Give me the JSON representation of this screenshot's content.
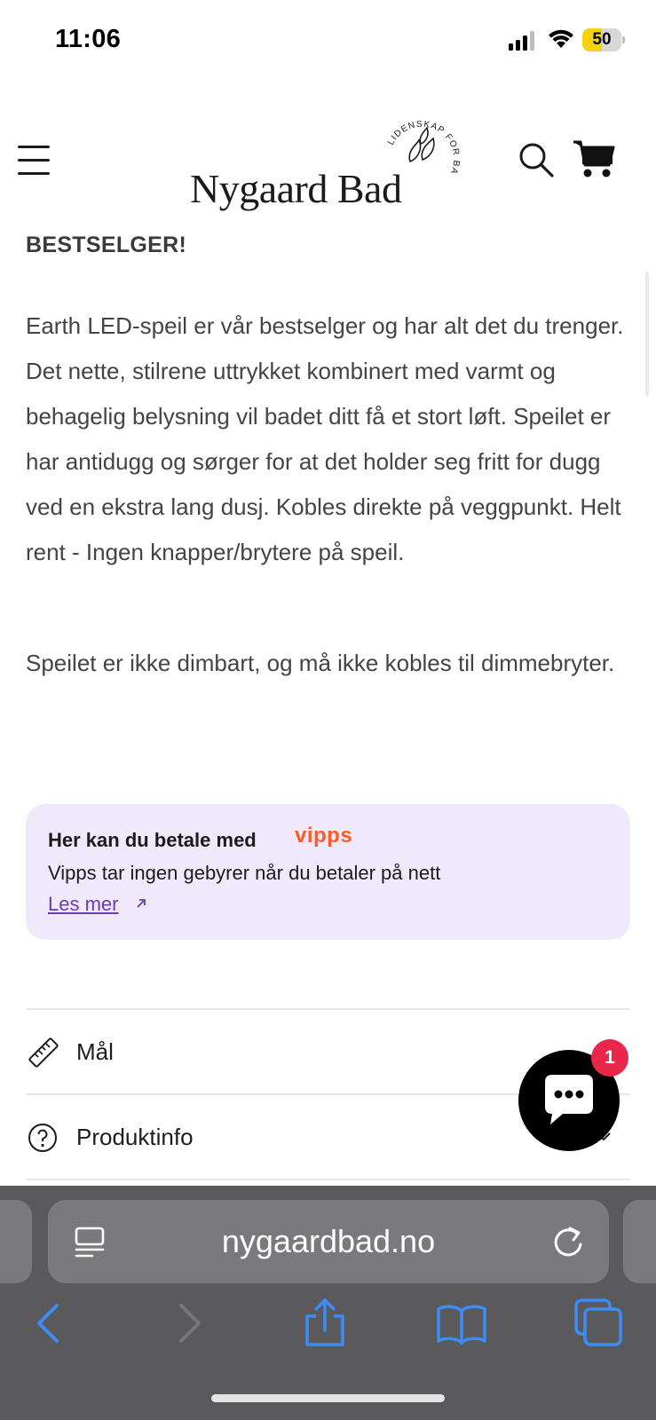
{
  "status_bar": {
    "time": "11:06",
    "battery_level": "50",
    "battery_fraction": 0.5
  },
  "header": {
    "logo_text": "Nygaard Bad",
    "logo_tagline": "LIDENSKAP FOR BADEROM"
  },
  "product": {
    "heading": "BESTSELGER!",
    "description": "Earth LED-speil er vår bestselger og har alt det du trenger. Det nette, stilrene uttrykket kombinert med varmt og behagelig belysning vil badet ditt få et stort løft. Speilet er har antidugg og sørger for at det holder seg fritt for dugg ved en ekstra lang dusj. Kobles direkte på veggpunkt. Helt rent - Ingen knapper/brytere på speil.",
    "note": "Speilet er ikke dimbart, og må ikke kobles til dimmebryter."
  },
  "vipps": {
    "title": "Her kan du betale med",
    "brand": "vipps",
    "subtitle": "Vipps tar ingen gebyrer når du betaler på nett",
    "link_label": "Les mer",
    "brand_color": "#ff5b24",
    "background_color": "#efe9fb"
  },
  "accordions": [
    {
      "label": "Mål",
      "icon": "ruler-icon"
    },
    {
      "label": "Produktinfo",
      "icon": "question-circle-icon"
    }
  ],
  "chat": {
    "badge_count": "1"
  },
  "browser": {
    "url": "nygaardbad.no"
  },
  "colors": {
    "accent_blue": "#3b8cf7",
    "badge_red": "#e9274a",
    "link_purple": "#6b3bb8"
  }
}
